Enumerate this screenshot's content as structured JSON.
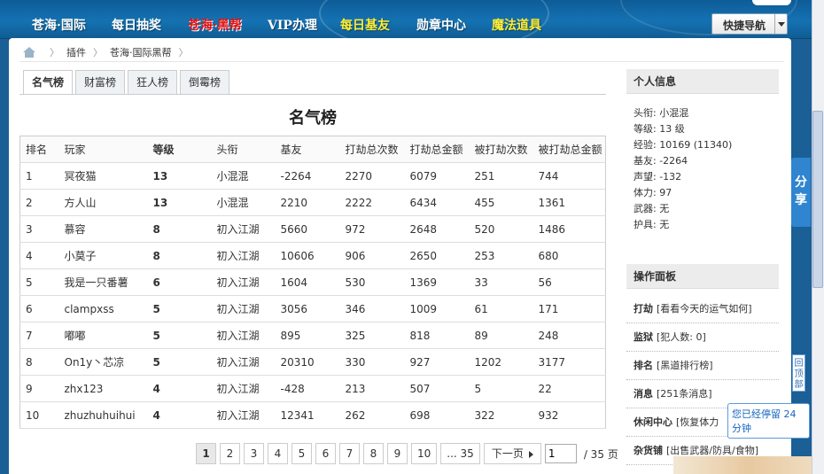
{
  "topnav": {
    "items": [
      {
        "label": "苍海·国际",
        "style": "white"
      },
      {
        "label": "每日抽奖",
        "style": "white"
      },
      {
        "label": "苍海·黑帮",
        "style": "red"
      },
      {
        "label": "VIP办理",
        "style": "white"
      },
      {
        "label": "每日基友",
        "style": "yellow"
      },
      {
        "label": "勋章中心",
        "style": "white"
      },
      {
        "label": "魔法道具",
        "style": "yellow"
      }
    ],
    "quick_nav": "快捷导航"
  },
  "breadcrumb": [
    "插件",
    "苍海·国际黑帮"
  ],
  "tabs": [
    "名气榜",
    "财富榜",
    "狂人榜",
    "倒霉榜"
  ],
  "table": {
    "title": "名气榜",
    "headers": [
      "排名",
      "玩家",
      "等级",
      "头衔",
      "基友",
      "打劫总次数",
      "打劫总金额",
      "被打劫次数",
      "被打劫总金额"
    ],
    "rows": [
      [
        "1",
        "冥夜猫",
        "13",
        "小混混",
        "-2264",
        "2270",
        "6079",
        "251",
        "744"
      ],
      [
        "2",
        "方人山",
        "13",
        "小混混",
        "2210",
        "2222",
        "6434",
        "455",
        "1361"
      ],
      [
        "3",
        "慕容",
        "8",
        "初入江湖",
        "5660",
        "972",
        "2648",
        "520",
        "1486"
      ],
      [
        "4",
        "小莫子",
        "8",
        "初入江湖",
        "10606",
        "906",
        "2650",
        "253",
        "680"
      ],
      [
        "5",
        "我是一只番薯",
        "6",
        "初入江湖",
        "1604",
        "530",
        "1369",
        "33",
        "56"
      ],
      [
        "6",
        "clampxss",
        "5",
        "初入江湖",
        "3056",
        "346",
        "1009",
        "61",
        "171"
      ],
      [
        "7",
        "嘟嘟",
        "5",
        "初入江湖",
        "895",
        "325",
        "818",
        "89",
        "248"
      ],
      [
        "8",
        "On1y丶芯凉",
        "5",
        "初入江湖",
        "20310",
        "330",
        "927",
        "1202",
        "3177"
      ],
      [
        "9",
        "zhx123",
        "4",
        "初入江湖",
        "-428",
        "213",
        "507",
        "5",
        "22"
      ],
      [
        "10",
        "zhuzhuhuihui",
        "4",
        "初入江湖",
        "12341",
        "262",
        "698",
        "322",
        "932"
      ]
    ]
  },
  "pagination": {
    "pages": [
      "1",
      "2",
      "3",
      "4",
      "5",
      "6",
      "7",
      "8",
      "9",
      "10",
      "... 35"
    ],
    "current": "1",
    "next_label": "下一页",
    "input_value": "1",
    "total": "/ 35 页"
  },
  "personal_info": {
    "title": "个人信息",
    "lines": [
      "头衔: 小混混",
      "等级: 13 级",
      "经验: 10169 (11340)",
      "基友: -2264",
      "声望: -132",
      "体力: 97",
      "武器: 无",
      "护具: 无"
    ]
  },
  "operations": {
    "title": "操作面板",
    "items": [
      {
        "name": "打劫",
        "desc": "[看看今天的运气如何]"
      },
      {
        "name": "监狱",
        "desc": "[犯人数: 0]"
      },
      {
        "name": "排名",
        "desc": "[黑道排行榜]"
      },
      {
        "name": "消息",
        "desc": "[251条消息]"
      },
      {
        "name": "休闲中心",
        "desc": "[恢复体力"
      },
      {
        "name": "杂货铺",
        "desc": "[出售武器/防具/食物]"
      }
    ]
  },
  "share_label": "分享",
  "back_top_label": "回顶部",
  "stay_note": "您已经停留 24 分钟"
}
